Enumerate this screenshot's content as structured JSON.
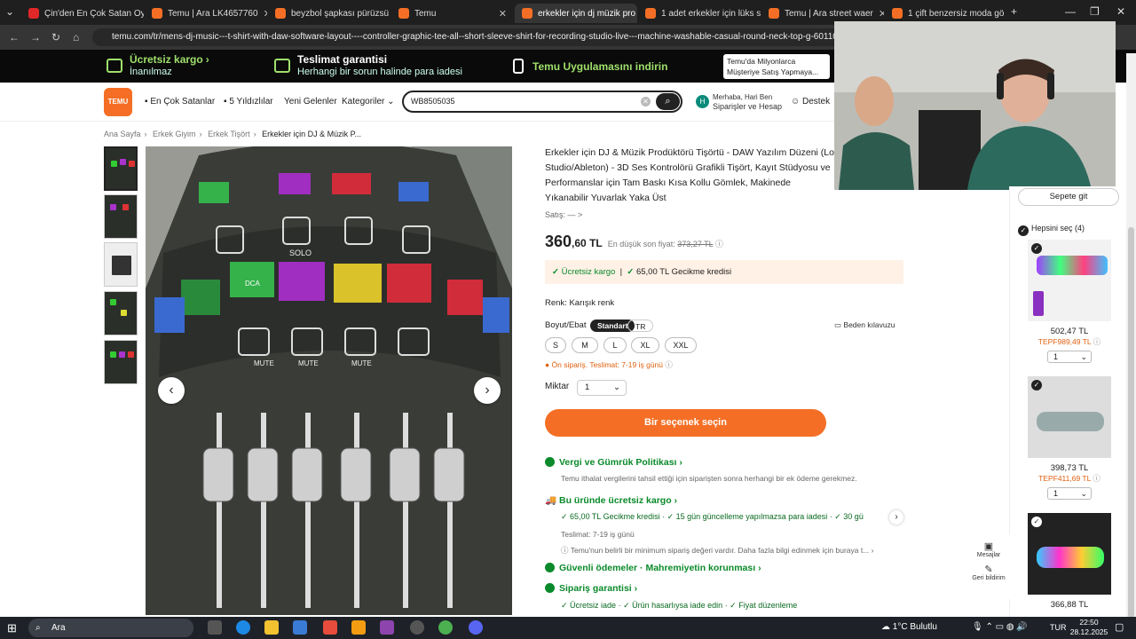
{
  "tabs": [
    {
      "label": "Çin'den En Çok Satan Oyu",
      "icon": "youtube-icon",
      "active": false
    },
    {
      "label": "Temu | Ara LK4657760",
      "icon": "temu-icon",
      "active": false
    },
    {
      "label": "beyzbol şapkası pürüzsü",
      "icon": "temu-icon",
      "active": false
    },
    {
      "label": "Temu",
      "icon": "temu-icon",
      "active": false
    },
    {
      "label": "erkekler için dj müzik pro",
      "icon": "temu-icon",
      "active": true
    },
    {
      "label": "1 adet erkekler için lüks s",
      "icon": "temu-icon",
      "active": false
    },
    {
      "label": "Temu | Ara street waer",
      "icon": "temu-icon",
      "active": false
    },
    {
      "label": "1 çift benzersiz moda gö",
      "icon": "temu-icon",
      "active": false
    }
  ],
  "url": "temu.com/tr/mens-dj-music---t-shirt-with-daw-software-layout----controller-graphic-tee-all--short-sleeve-shirt-for-recording-studio-live---machine-washable-casual-round-neck-top-g-6011040307",
  "promo": {
    "shipping_title": "Ücretsiz kargo",
    "shipping_sub": "İnanılmaz",
    "guarantee_title": "Teslimat garantisi",
    "guarantee_sub": "Herhangi bir sorun halinde para iadesi",
    "app": "Temu Uygulamasını indirin",
    "ad": "Temu'da Milyonlarca Müşteriye Satış Yapmaya..."
  },
  "header": {
    "logo": "TEMU",
    "nav": [
      "En Çok Satanlar",
      "5 Yıldızlılar",
      "Yeni Gelenler",
      "Kategoriler"
    ],
    "search_value": "WB8505035",
    "user_greeting": "Merhaba, Hari Ben",
    "user_sub": "Siparişler ve Hesap",
    "support": "Destek"
  },
  "breadcrumb": [
    "Ana Sayfa",
    "Erkek Giyim",
    "Erkek Tişört",
    "Erkekler için DJ & Müzik P..."
  ],
  "product": {
    "title": "Erkekler için DJ & Müzik Prodüktörü Tişörtü - DAW Yazılım Düzeni (Lo Studio/Ableton) - 3D Ses Kontrolörü Grafikli Tişört, Kayıt Stüdyosu ve Performanslar için Tam Baskı Kısa Kollu Gömlek, Makinede Yıkanabilir Yuvarlak Yaka Üst",
    "sales": "Satış: — >",
    "price_main": "360",
    "price_rest": ",60 TL",
    "lowest_label": "En düşük son fiyat:",
    "lowest_value": "373,27 TL",
    "offer_shipping": "Ücretsiz kargo",
    "offer_credit": "65,00 TL Gecikme kredisi",
    "color_label": "Renk: Karışık renk",
    "size_label": "Boyut/Ebat",
    "size_toggle": [
      "Standart",
      "TR"
    ],
    "size_guide": "Beden kılavuzu",
    "sizes": [
      "S",
      "M",
      "L",
      "XL",
      "XXL"
    ],
    "delivery_note": "Ön sipariş. Teslimat: 7-19 iş günü",
    "qty_label": "Miktar",
    "qty_value": "1",
    "cta": "Bir seçenek seçin"
  },
  "sections": {
    "tax_title": "Vergi ve Gümrük Politikası",
    "tax_desc": "Temu ithalat vergilerini tahsil ettiği için siparişten sonra herhangi bir ek ödeme gerekmez.",
    "ship_title": "Bu üründe ücretsiz kargo",
    "ship_items": [
      "65,00 TL Gecikme kredisi",
      "15 gün güncelleme yapılmazsa para iadesi",
      "30 gü"
    ],
    "ship_delivery": "Teslimat: 7-19 iş günü",
    "ship_note": "Temu'nun belirli bir minimum sipariş değeri vardır. Daha fazla bilgi edinmek için buraya t...",
    "secure_title": "Güvenli ödemeler · Mahremiyetin korunması",
    "order_title": "Sipariş garantisi",
    "order_items": [
      "Ücretsiz iade",
      "Ürün hasarlıysa iade edin",
      "Fiyat düzenleme"
    ]
  },
  "cart": {
    "go_cart": "Sepete git",
    "select_all": "Hepsini seç (4)",
    "items": [
      {
        "price": "502,47 TL",
        "old": "TEPF989,49 TL",
        "qty": "1"
      },
      {
        "price": "398,73 TL",
        "old": "TEPF411,69 TL",
        "qty": "1"
      },
      {
        "price": "366,88 TL",
        "old": "",
        "qty": ""
      }
    ]
  },
  "side": {
    "messages": "Mesajlar",
    "feedback": "Geri bildirim"
  },
  "taskbar": {
    "search": "Ara",
    "weather": "1°C  Bulutlu",
    "lang": "TUR",
    "time": "22:50",
    "date": "28.12.2025"
  },
  "mainimage_labels": {
    "solo": "SOLO",
    "mute": "MUTE",
    "dca": "DCA"
  },
  "colors": {
    "accent": "#f46f25",
    "green": "#0a8a2a",
    "promo_bg": "#0a0a0a"
  }
}
